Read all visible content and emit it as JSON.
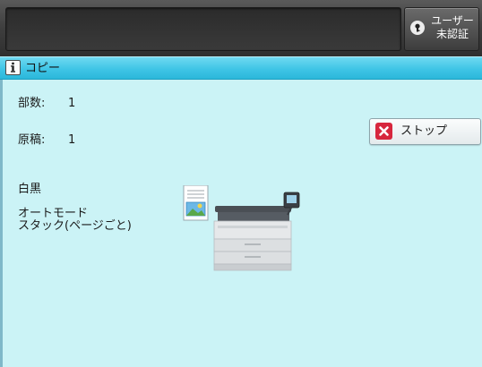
{
  "header": {
    "user_status_label_line1": "ユーザー",
    "user_status_label_line2": "未認証",
    "user_icon": "key-icon"
  },
  "title_bar": {
    "icon": "info-icon",
    "title": "コピー"
  },
  "job_info": {
    "copies_label": "部数:",
    "copies_value": "1",
    "originals_label": "原稿:",
    "originals_value": "1",
    "color_mode": "白黒",
    "setting_line1": "オートモード",
    "setting_line2": "スタック(ページごと)"
  },
  "stop_button": {
    "label": "ストップ",
    "icon": "close-x-icon",
    "icon_color": "#d7263d"
  },
  "graphic": {
    "document_icon": "document-icon",
    "device_icon": "multifunction-printer-icon"
  },
  "colors": {
    "title_bar": "#3fc5e6",
    "content_background": "#cbf3f6",
    "top_bar": "#3e3e3e"
  }
}
